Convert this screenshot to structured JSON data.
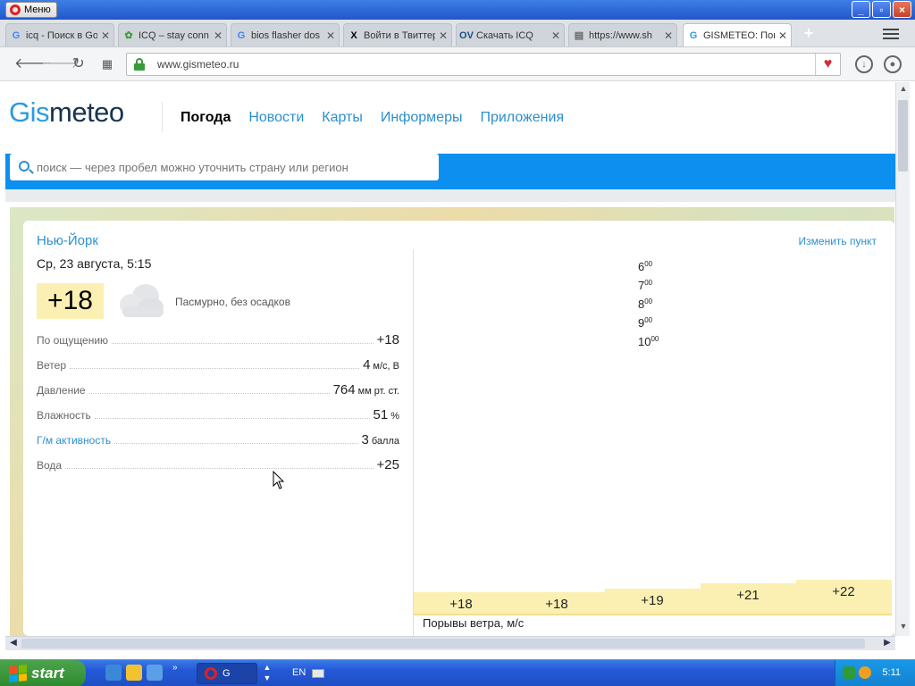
{
  "window": {
    "menu_label": "Меню",
    "buttons": [
      "_",
      "▫",
      "×"
    ]
  },
  "tabs": [
    {
      "label": "icq - Поиск в Go",
      "favicon": "G",
      "color": "#4285f4"
    },
    {
      "label": "ICQ – stay conn",
      "favicon": "✿",
      "color": "#3aa03a"
    },
    {
      "label": "bios flasher dos",
      "favicon": "G",
      "color": "#4285f4"
    },
    {
      "label": "Войти в Твиттер",
      "favicon": "X",
      "color": "#000000"
    },
    {
      "label": "Скачать ICQ",
      "favicon": "OV",
      "color": "#1a4e8a"
    },
    {
      "label": "https://www.sh",
      "favicon": "▤",
      "color": "#666666"
    },
    {
      "label": "GISMETEO: Пог",
      "favicon": "G",
      "color": "#2d9be0",
      "active": true
    }
  ],
  "address": {
    "url": "www.gismeteo.ru"
  },
  "site": {
    "logo_part1": "Gis",
    "logo_part2": "meteo",
    "nav": [
      {
        "label": "Погода",
        "current": true
      },
      {
        "label": "Новости"
      },
      {
        "label": "Карты"
      },
      {
        "label": "Информеры"
      },
      {
        "label": "Приложения"
      }
    ],
    "search_placeholder": "поиск — через пробел можно уточнить страну или регион"
  },
  "weather": {
    "city": "Нью-Йорк",
    "change_point": "Изменить пункт",
    "datetime": "Ср, 23 августа, 5:15",
    "temperature": "+18",
    "condition": "Пасмурно, без осадков",
    "params": [
      {
        "label": "По ощущению",
        "value": "+18",
        "unit": ""
      },
      {
        "label": "Ветер",
        "value": "4",
        "unit": "м/с, В"
      },
      {
        "label": "Давление",
        "value": "764",
        "unit": "мм рт. ст."
      },
      {
        "label": "Влажность",
        "value": "51",
        "unit": "%"
      },
      {
        "label": "Г/м активность",
        "value": "3",
        "unit": "балла",
        "link": true
      },
      {
        "label": "Вода",
        "value": "",
        "unit": "+25"
      }
    ],
    "hours": [
      "6",
      "7",
      "8",
      "9",
      "10"
    ],
    "hour_suffix": "00",
    "hourly_temps": [
      "+18",
      "+18",
      "+19",
      "+21",
      "+22"
    ],
    "gusts_label": "Порывы ветра, м/с"
  },
  "taskbar": {
    "start_label": "start",
    "task_label": "G",
    "lang": "EN",
    "clock": "5:11"
  }
}
